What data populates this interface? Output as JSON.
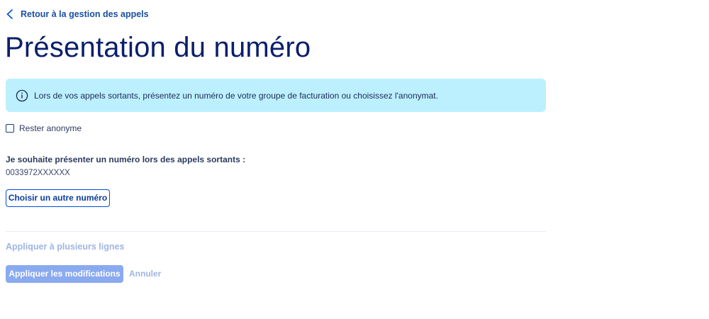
{
  "back_link": {
    "label": "Retour à la gestion des appels",
    "icon": "chevron-left-icon"
  },
  "page": {
    "title": "Présentation du numéro"
  },
  "info_banner": {
    "icon": "info-circle-icon",
    "text": "Lors de vos appels sortants, présentez un numéro de votre groupe de facturation ou choisissez l'anonymat."
  },
  "anonymous_option": {
    "label": "Rester anonyme",
    "checked": false
  },
  "number_section": {
    "label": "Je souhaite présenter un numéro lors des appels sortants :",
    "current_number": "0033972XXXXXX",
    "choose_button_label": "Choisir un autre numéro"
  },
  "footer": {
    "apply_many_label": "Appliquer à plusieurs lignes",
    "apply_label": "Appliquer les modifications",
    "cancel_label": "Annuler"
  },
  "colors": {
    "primary": "#0050d7",
    "title": "#0a1f6b",
    "banner_bg": "#bdf0ff",
    "disabled_button": "#8aaaf0",
    "disabled_link": "#9fb5e2"
  }
}
